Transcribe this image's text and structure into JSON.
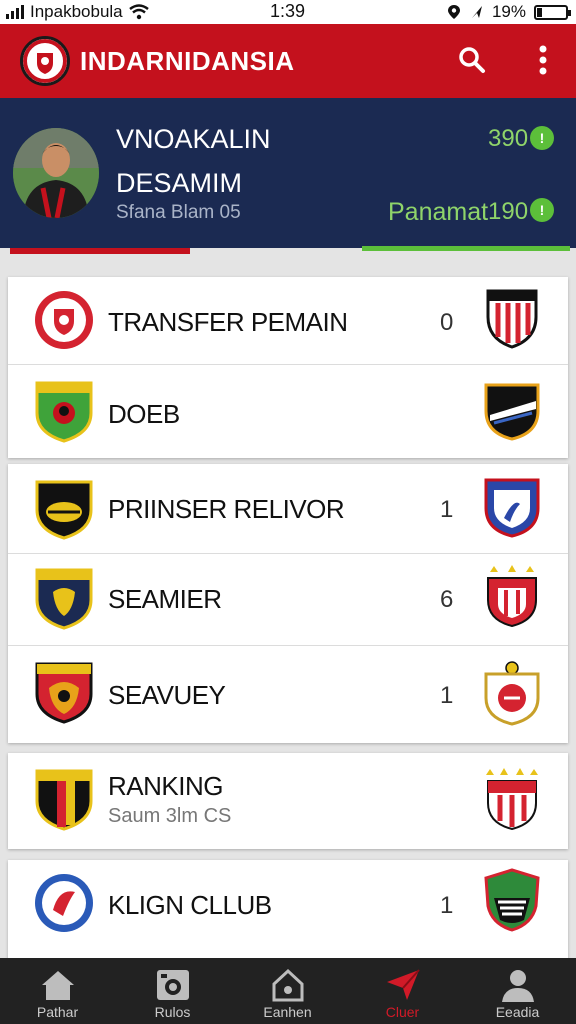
{
  "status_bar": {
    "carrier": "Inpakbobula",
    "time": "1:39",
    "battery": "19%",
    "battery_level": 0.19
  },
  "app_bar": {
    "title": "INDARNIDANSIA",
    "icons": [
      "club-logo-icon",
      "search-icon",
      "more-vert-icon"
    ]
  },
  "profile": {
    "name_line1": "VNOAKALIN",
    "name_line2": "DESAMIM",
    "meta": "Sfana Blam 05",
    "score1": "390",
    "score_label": "Panamat",
    "score2": "190",
    "badge_glyph": "!",
    "accent_green": "#5cbf3a"
  },
  "cards": [
    {
      "rows": [
        {
          "label": "TRANSFER PEMAIN",
          "count": "0"
        },
        {
          "label": "DOEB",
          "count": ""
        }
      ]
    },
    {
      "rows": [
        {
          "label": "PRIINSER RELIVOR",
          "count": "1"
        },
        {
          "label": "SEAMIER",
          "count": "6"
        },
        {
          "label": "SEAVUEY",
          "count": "1"
        }
      ]
    },
    {
      "rows": [
        {
          "label": "RANKING",
          "sub": "Saum 3lm CS",
          "count": ""
        }
      ]
    },
    {
      "rows": [
        {
          "label": "KLIGN CLLUB",
          "count": "1"
        }
      ]
    }
  ],
  "bottom_nav": [
    {
      "label": "Pathar",
      "icon": "home-icon"
    },
    {
      "label": "Rulos",
      "icon": "calendar-icon"
    },
    {
      "label": "Eanhen",
      "icon": "house-outline-icon"
    },
    {
      "label": "Cluer",
      "icon": "send-icon",
      "active": true
    },
    {
      "label": "Eeadia",
      "icon": "person-icon"
    }
  ],
  "colors": {
    "brand_red": "#c4111d",
    "profile_navy": "#1b2a52",
    "nav_dark": "#222222"
  }
}
